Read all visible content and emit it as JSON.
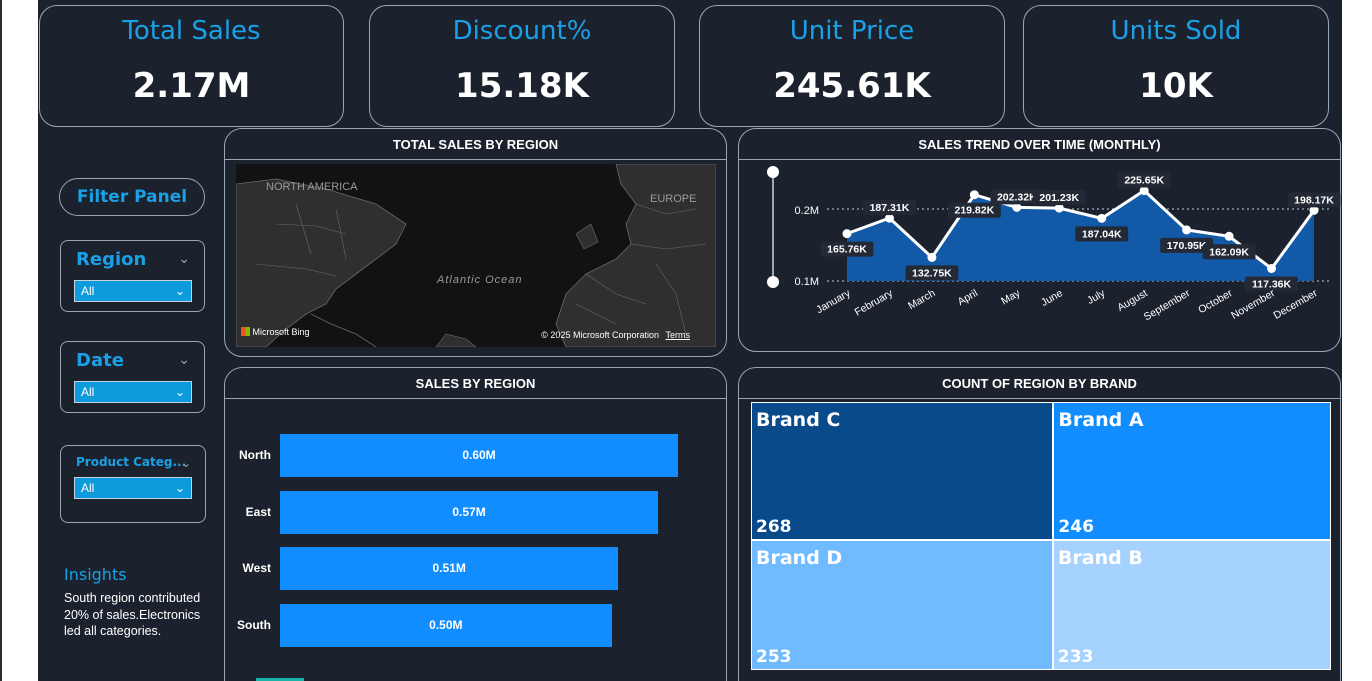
{
  "kpis": [
    {
      "title": "Total Sales",
      "value": "2.17M"
    },
    {
      "title": "Discount%",
      "value": "15.18K"
    },
    {
      "title": "Unit Price",
      "value": "245.61K"
    },
    {
      "title": "Units Sold",
      "value": "10K"
    }
  ],
  "filter_panel": {
    "label": "Filter Panel",
    "region": {
      "title": "Region",
      "value": "All"
    },
    "date": {
      "title": "Date",
      "value": "All"
    },
    "product_category": {
      "title": "Product Categ...",
      "value": "All"
    }
  },
  "insights": {
    "title": "Insights",
    "text": "South region contributed 20% of sales.Electronics led all categories."
  },
  "map_panel": {
    "title": "TOTAL SALES BY REGION",
    "labels": {
      "north_america": "NORTH AMERICA",
      "europe": "EUROPE",
      "ocean": "Atlantic Ocean"
    },
    "attribution": "© 2025 Microsoft Corporation",
    "terms": "Terms",
    "bing": "Microsoft Bing"
  },
  "trend_panel": {
    "title": "SALES TREND OVER TIME (MONTHLY)",
    "yticks": [
      "0.2M",
      "0.1M"
    ]
  },
  "region_panel": {
    "title": "SALES BY REGION"
  },
  "brand_panel": {
    "title": "COUNT OF REGION BY BRAND"
  },
  "colors": {
    "background": "#1b222d",
    "accent": "#1aa0e6",
    "bar": "#118dff",
    "area": "#1259a8",
    "brand_c": "#084a8a",
    "brand_a": "#118dff",
    "brand_d": "#70baff",
    "brand_b": "#a5d2ff"
  },
  "chart_data": [
    {
      "type": "area",
      "title": "SALES TREND OVER TIME (MONTHLY)",
      "categories": [
        "January",
        "February",
        "March",
        "April",
        "May",
        "June",
        "July",
        "August",
        "September",
        "October",
        "November",
        "December"
      ],
      "values": [
        165760,
        187310,
        132750,
        219820,
        202320,
        201230,
        187040,
        225650,
        170950,
        162090,
        117360,
        198170
      ],
      "data_labels": [
        "165.76K",
        "187.31K",
        "132.75K",
        "219.82K",
        "202.32K",
        "201.23K",
        "187.04K",
        "225.65K",
        "170.95K",
        "162.09K",
        "117.36K",
        "198.17K"
      ],
      "ylim": [
        100000,
        200000
      ],
      "grid": true
    },
    {
      "type": "bar",
      "orientation": "horizontal",
      "title": "SALES BY REGION",
      "categories": [
        "North",
        "East",
        "West",
        "South"
      ],
      "values": [
        0.6,
        0.57,
        0.51,
        0.5
      ],
      "data_labels": [
        "0.60M",
        "0.57M",
        "0.51M",
        "0.50M"
      ]
    },
    {
      "type": "treemap",
      "title": "COUNT OF REGION BY BRAND",
      "categories": [
        "Brand C",
        "Brand A",
        "Brand D",
        "Brand B"
      ],
      "values": [
        268,
        246,
        253,
        233
      ]
    }
  ]
}
